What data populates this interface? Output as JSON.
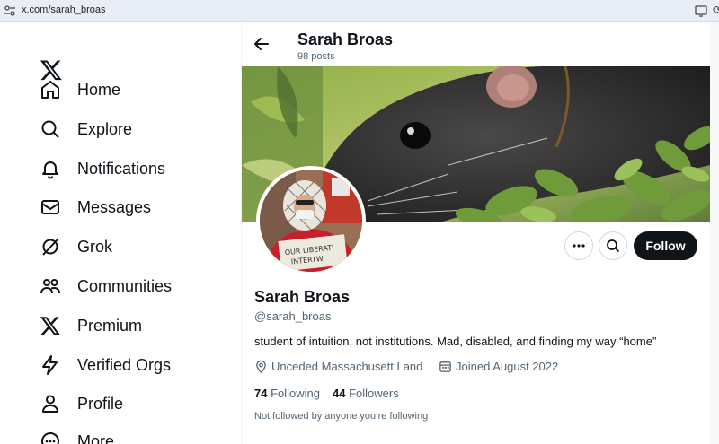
{
  "browser": {
    "url": "x.com/sarah_broas"
  },
  "nav": {
    "items": [
      {
        "label": "Home",
        "icon": "home-icon"
      },
      {
        "label": "Explore",
        "icon": "search-icon"
      },
      {
        "label": "Notifications",
        "icon": "bell-icon"
      },
      {
        "label": "Messages",
        "icon": "envelope-icon"
      },
      {
        "label": "Grok",
        "icon": "grok-icon"
      },
      {
        "label": "Communities",
        "icon": "people-icon"
      },
      {
        "label": "Premium",
        "icon": "x-logo-icon"
      },
      {
        "label": "Verified Orgs",
        "icon": "lightning-icon"
      },
      {
        "label": "Profile",
        "icon": "person-icon"
      },
      {
        "label": "More",
        "icon": "more-circle-icon"
      }
    ]
  },
  "header": {
    "name": "Sarah Broas",
    "posts": "98 posts"
  },
  "profile": {
    "name": "Sarah Broas",
    "handle": "@sarah_broas",
    "bio": "student of intuition, not institutions. Mad, disabled, and finding my way “home”",
    "location": "Unceded Massachusett Land",
    "joined": "Joined August 2022",
    "following_count": "74",
    "following_label": "Following",
    "followers_count": "44",
    "followers_label": "Followers",
    "not_followed": "Not followed by anyone you’re following",
    "follow_label": "Follow",
    "avatar_sign_text": "OUR LIBERATION IS INTERTWINED"
  },
  "colors": {
    "accent": "#0f1419",
    "muted": "#536471",
    "border": "#cfd9de"
  }
}
